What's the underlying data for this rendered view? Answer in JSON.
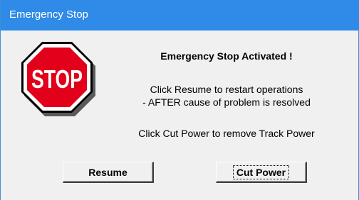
{
  "window": {
    "title": "Emergency Stop"
  },
  "stop_sign": {
    "text": "STOP",
    "fill_color": "#e2001a",
    "border_color": "#ffffff",
    "outline_color": "#000000"
  },
  "message": {
    "heading": "Emergency Stop Activated !",
    "line1": "Click Resume to restart operations",
    "line2": "- AFTER cause of problem is resolved",
    "line3": "Click Cut Power to remove Track Power"
  },
  "buttons": {
    "resume_label": "Resume",
    "cut_power_label": "Cut Power"
  },
  "colors": {
    "titlebar": "#2f8ae8",
    "dialog_background": "#f0f0f0"
  }
}
